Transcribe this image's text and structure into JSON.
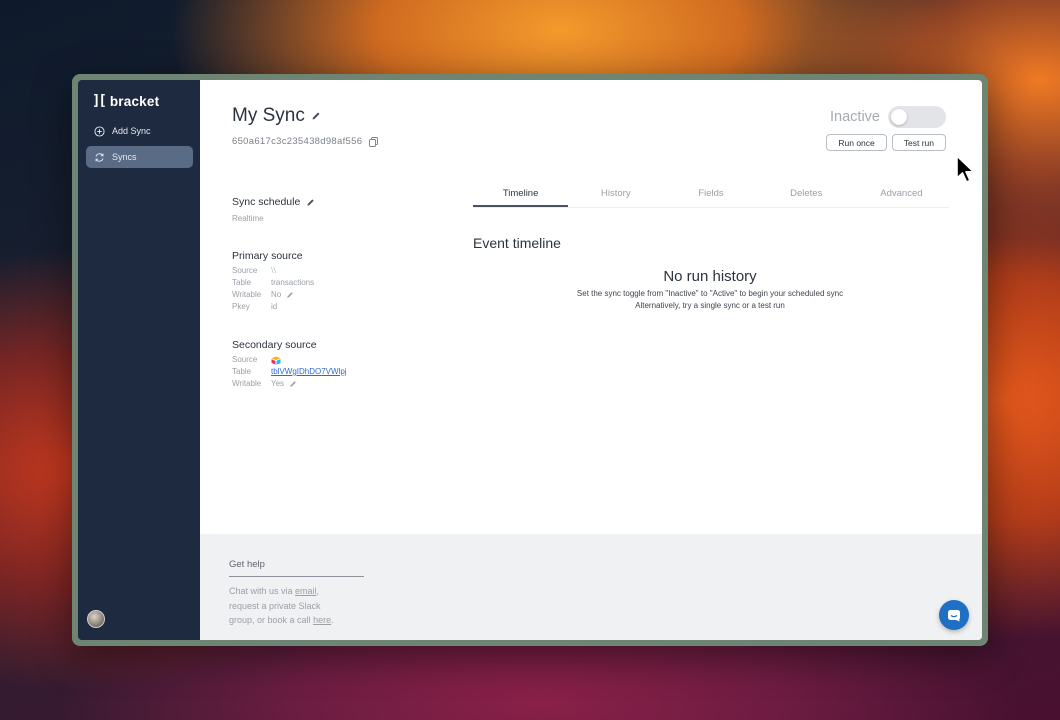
{
  "app": {
    "brand_mark": "][",
    "brand_name": "bracket"
  },
  "sidebar": {
    "items": [
      {
        "label": "Add Sync",
        "icon": "plus-circle-icon",
        "active": false
      },
      {
        "label": "Syncs",
        "icon": "refresh-icon",
        "active": true
      }
    ]
  },
  "sync": {
    "title": "My Sync",
    "id": "650a617c3c235438d98af556",
    "status_label": "Inactive",
    "active": false
  },
  "actions": {
    "run_once": "Run once",
    "test_run": "Test run"
  },
  "schedule": {
    "heading": "Sync schedule",
    "value": "Realtime"
  },
  "primary": {
    "heading": "Primary source",
    "source_key": "Source",
    "source_val": "⧵⧵",
    "table_key": "Table",
    "table_val": "transactions",
    "writable_key": "Writable",
    "writable_val": "No",
    "pkey_key": "Pkey",
    "pkey_val": "id"
  },
  "secondary": {
    "heading": "Secondary source",
    "source_key": "Source",
    "source_icon": "airtable-logo-icon",
    "table_key": "Table",
    "table_val": "tblVWgIDhDO7VWlpj",
    "writable_key": "Writable",
    "writable_val": "Yes"
  },
  "tabs": [
    {
      "label": "Timeline",
      "active": true
    },
    {
      "label": "History",
      "active": false
    },
    {
      "label": "Fields",
      "active": false
    },
    {
      "label": "Deletes",
      "active": false
    },
    {
      "label": "Advanced",
      "active": false
    }
  ],
  "timeline": {
    "heading": "Event timeline",
    "empty_title": "No run history",
    "empty_line1": "Set the sync toggle from \"Inactive\" to \"Active\" to begin your scheduled sync",
    "empty_line2": "Alternatively, try a single sync or a test run"
  },
  "help": {
    "heading": "Get help",
    "text1": "Chat with us via ",
    "link_email": "email",
    "text2": ",\nrequest a private Slack\ngroup, or book a call ",
    "link_here": "here",
    "text3": "."
  },
  "colors": {
    "sidebar_bg": "#1e2a3f",
    "sidebar_active": "#5a6b86",
    "link": "#2f6bd8",
    "chat_button": "#1f6fc4"
  }
}
